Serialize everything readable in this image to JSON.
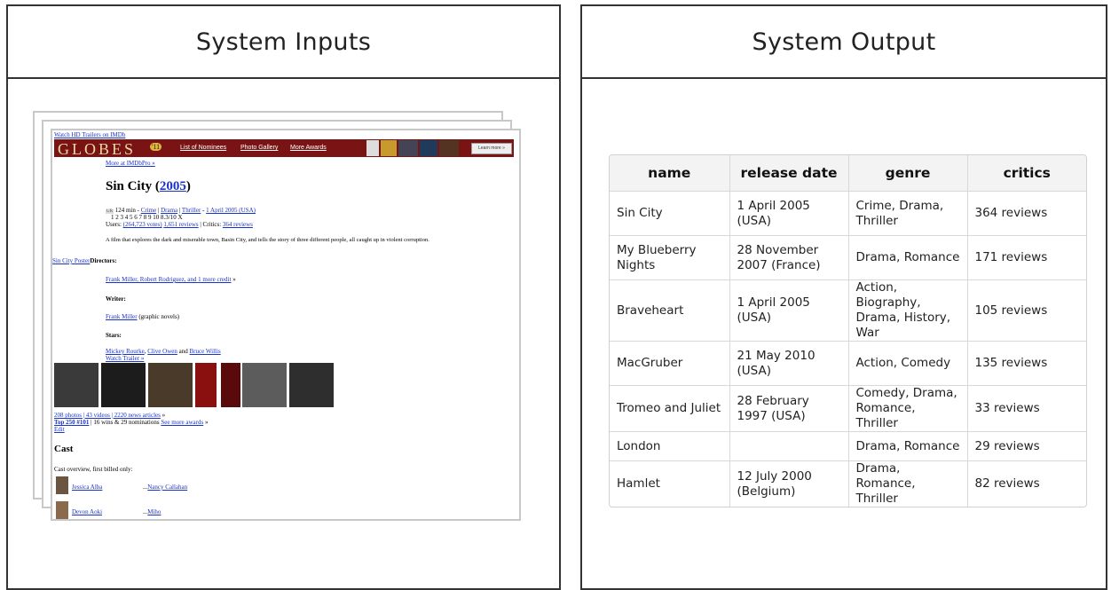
{
  "panels": {
    "inputs_title": "System Inputs",
    "output_title": "System Output"
  },
  "webpage": {
    "trailer_link": "Watch HD Trailers on IMDb",
    "banner": {
      "logo": "GLOBES",
      "badge": "'11",
      "links": [
        "List of Nominees",
        "Photo Gallery",
        "More Awards"
      ],
      "learn_more": "Learn more »"
    },
    "more_pro": "More at IMDbPro »",
    "title": "Sin City (",
    "year": "2005",
    "title_close": ")",
    "meta": {
      "rating_badge": "UR",
      "runtime": "124 min",
      "genres": [
        "Crime",
        "Drama",
        "Thriller"
      ],
      "release": "1 April 2005 (USA)",
      "rating_scale": "1 2 3 4 5 6 7 8 9 10 8.3/10 X",
      "users_prefix": "Users:",
      "votes": "(264,723 votes)",
      "user_reviews": "1,651 reviews",
      "critics_prefix": "| Critics:",
      "critic_reviews": "364 reviews"
    },
    "synopsis": "A film that explores the dark and miserable town, Basin City, and tells the story of three different people, all caught up in violent corruption.",
    "poster_alt": "Sin City Poster",
    "directors_label": "Directors:",
    "directors": "Frank Miller, Robert Rodriguez, and 1 more credit",
    "directors_suffix": "»",
    "writer_label": "Writer:",
    "writer": "Frank Miller",
    "writer_note": "(graphic novels)",
    "stars_label": "Stars:",
    "stars": [
      "Mickey Rourke",
      "Clive Owen",
      "Bruce Willis"
    ],
    "stars_and": "and",
    "watch_trailer": "Watch Trailer »",
    "media_links": "208 photos | 43 videos | 2220 news articles",
    "media_suffix": "»",
    "top250": "Top 250 #101",
    "awards_text": "| 16 wins & 29 nominations",
    "see_more_awards": "See more awards",
    "awards_suffix": "»",
    "edit": "Edit",
    "cast_heading": "Cast",
    "cast_overview": "Cast overview, first billed only:",
    "cast": [
      {
        "actor": "Jessica Alba",
        "role": "Nancy Callahan"
      },
      {
        "actor": "Devon Aoki",
        "role": "Miho"
      }
    ],
    "cast_role_prefix": "..."
  },
  "table": {
    "headers": [
      "name",
      "release date",
      "genre",
      "critics"
    ],
    "rows": [
      [
        "Sin City",
        "1 April 2005 (USA)",
        "Crime, Drama, Thriller",
        "364 reviews"
      ],
      [
        "My Blueberry Nights",
        "28 November 2007 (France)",
        "Drama, Romance",
        "171 reviews"
      ],
      [
        "Braveheart",
        "1 April 2005 (USA)",
        "Action, Biography, Drama, History, War",
        "105 reviews"
      ],
      [
        "MacGruber",
        "21 May 2010 (USA)",
        "Action, Comedy",
        "135 reviews"
      ],
      [
        "Tromeo and Juliet",
        "28 February 1997 (USA)",
        "Comedy, Drama, Romance, Thriller",
        "33 reviews"
      ],
      [
        "London",
        "",
        "Drama, Romance",
        "29 reviews"
      ],
      [
        "Hamlet",
        "12 July 2000 (Belgium)",
        "Drama, Romance, Thriller",
        "82 reviews"
      ]
    ]
  }
}
